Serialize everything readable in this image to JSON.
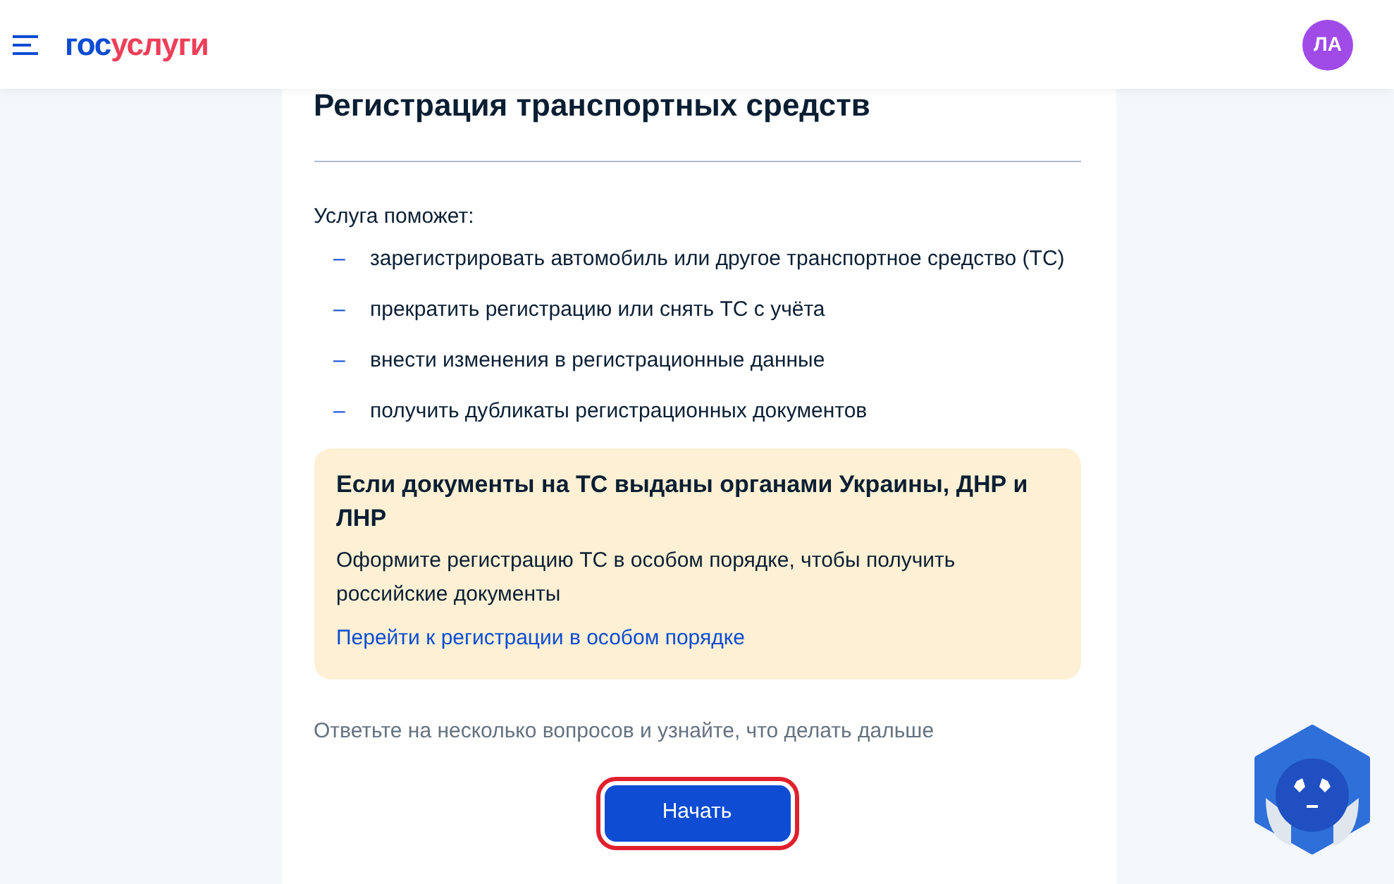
{
  "header": {
    "logo": {
      "first": "гос",
      "second": "услуги"
    },
    "avatar": "ЛА"
  },
  "card": {
    "title": "Регистрация транспортных средств",
    "intro": "Услуга поможет:",
    "bullets": [
      {
        "marker": "–",
        "text": "зарегистрировать автомобиль или другое транспортное средство (ТС)"
      },
      {
        "marker": "–",
        "text": "прекратить регистрацию или снять ТС с учёта"
      },
      {
        "marker": "–",
        "text": "внести изменения в регистрационные данные"
      },
      {
        "marker": "–",
        "text": "получить дубликаты регистрационных документов"
      }
    ],
    "notice": {
      "title": "Если документы на ТС выданы органами Украины, ДНР и ЛНР",
      "text": "Оформите регистрацию ТС в особом порядке, чтобы получить российские документы",
      "link": "Перейти к регистрации в особом порядке"
    },
    "prompt": "Ответьте на несколько вопросов и узнайте, что делать дальше",
    "button": {
      "label": "Начать",
      "highlighted": true
    }
  }
}
